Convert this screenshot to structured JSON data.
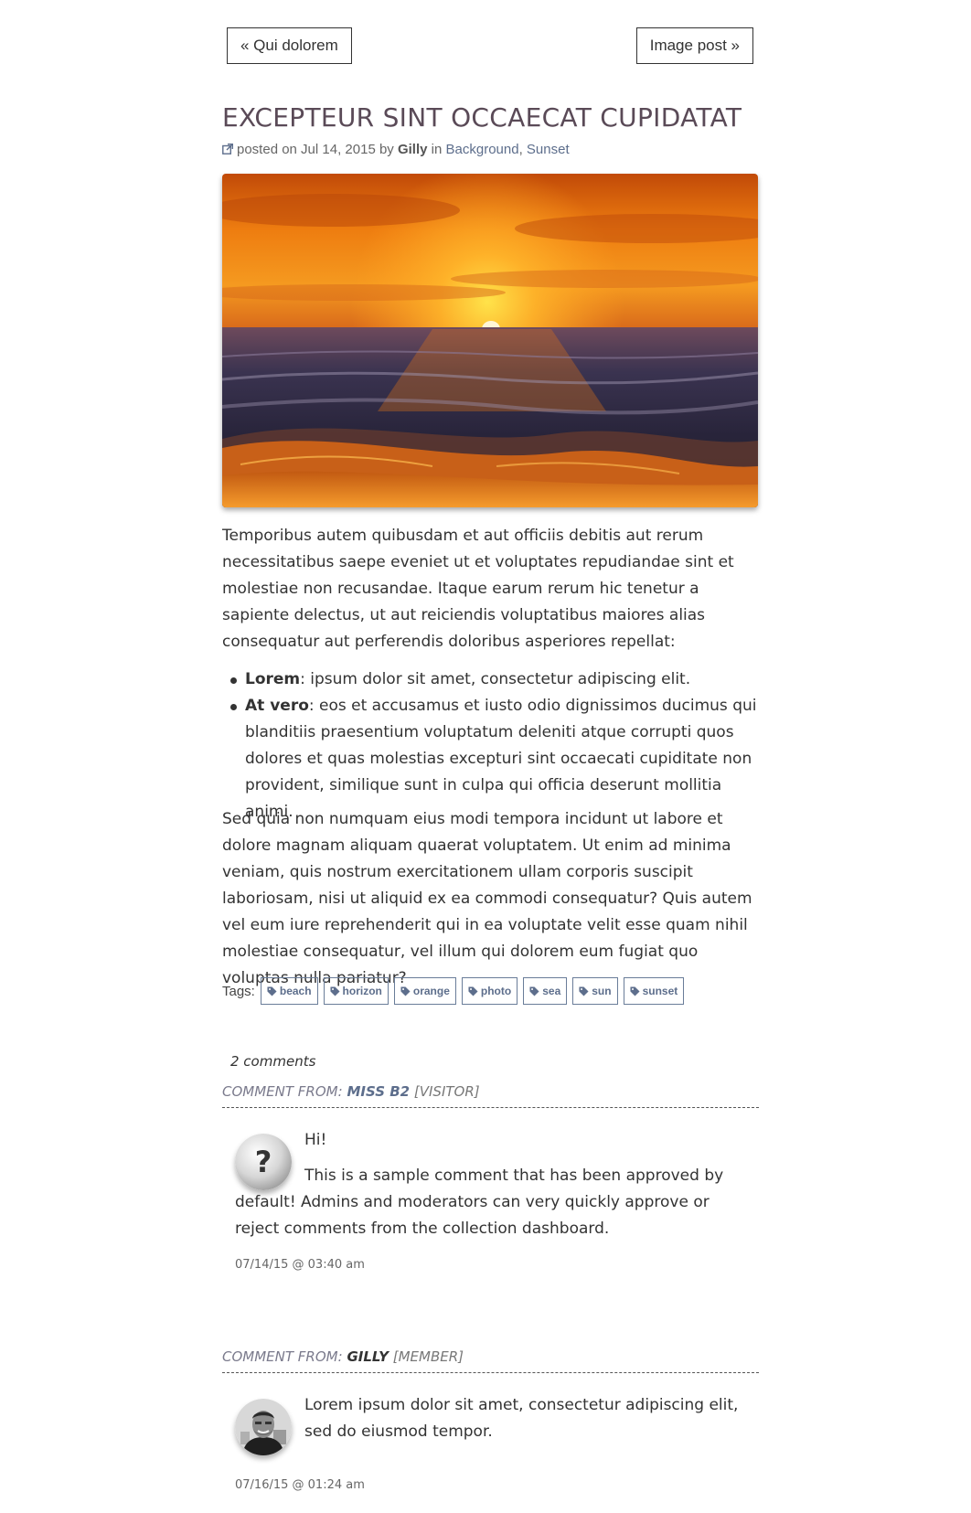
{
  "nav": {
    "prev_label": "« Qui dolorem",
    "next_label": "Image post »"
  },
  "post": {
    "title": "EXCEPTEUR SINT OCCAECAT CUPIDATAT",
    "meta": {
      "posted_on": "posted on Jul 14, 2015 by",
      "author": "Gilly",
      "in_label": "in",
      "category_1": "Background",
      "separator": ",",
      "category_2": "Sunset"
    },
    "paragraph_1": "Temporibus autem quibusdam et aut officiis debitis aut rerum necessitatibus saepe eveniet ut et voluptates repudiandae sint et molestiae non recusandae. Itaque earum rerum hic tenetur a sapiente delectus, ut aut reiciendis voluptatibus maiores alias consequatur aut perferendis doloribus asperiores repellat:",
    "list": [
      {
        "term": "Lorem",
        "text": ": ipsum dolor sit amet, consectetur adipiscing elit."
      },
      {
        "term": "At vero",
        "text": ": eos et accusamus et iusto odio dignissimos ducimus qui blanditiis praesentium voluptatum deleniti atque corrupti quos dolores et quas molestias excepturi sint occaecati cupiditate non provident, similique sunt in culpa qui officia deserunt mollitia animi."
      }
    ],
    "paragraph_2": "Sed quia non numquam eius modi tempora incidunt ut labore et dolore magnam aliquam quaerat voluptatem. Ut enim ad minima veniam, quis nostrum exercitationem ullam corporis suscipit laboriosam, nisi ut aliquid ex ea commodi consequatur? Quis autem vel eum iure reprehenderit qui in ea voluptate velit esse quam nihil molestiae consequatur, vel illum qui dolorem eum fugiat quo voluptas nulla pariatur?",
    "tags_label": "Tags:",
    "tags": [
      "beach",
      "horizon",
      "orange",
      "photo",
      "sea",
      "sun",
      "sunset"
    ]
  },
  "comments": {
    "count_label": "2 comments",
    "items": [
      {
        "prefix": "COMMENT FROM:",
        "author": "MISS B2",
        "role": "[VISITOR]",
        "avatar_icon": "question-mark-icon",
        "line_1": "Hi!",
        "line_2": "This is a sample comment that has been approved by default! Admins and moderators can very quickly approve or reject comments from the collection dashboard.",
        "date": "07/14/15 @ 03:40 am"
      },
      {
        "prefix": "COMMENT FROM:",
        "author": "GILLY",
        "role": "[MEMBER]",
        "avatar_icon": "user-photo",
        "line_1": "Lorem ipsum dolor sit amet, consectetur adipiscing elit, sed do eiusmod tempor.",
        "date": "07/16/15 @ 01:24 am"
      }
    ]
  },
  "colors": {
    "title": "#5a4a57",
    "link": "#5d6e8c",
    "text": "#333333"
  }
}
